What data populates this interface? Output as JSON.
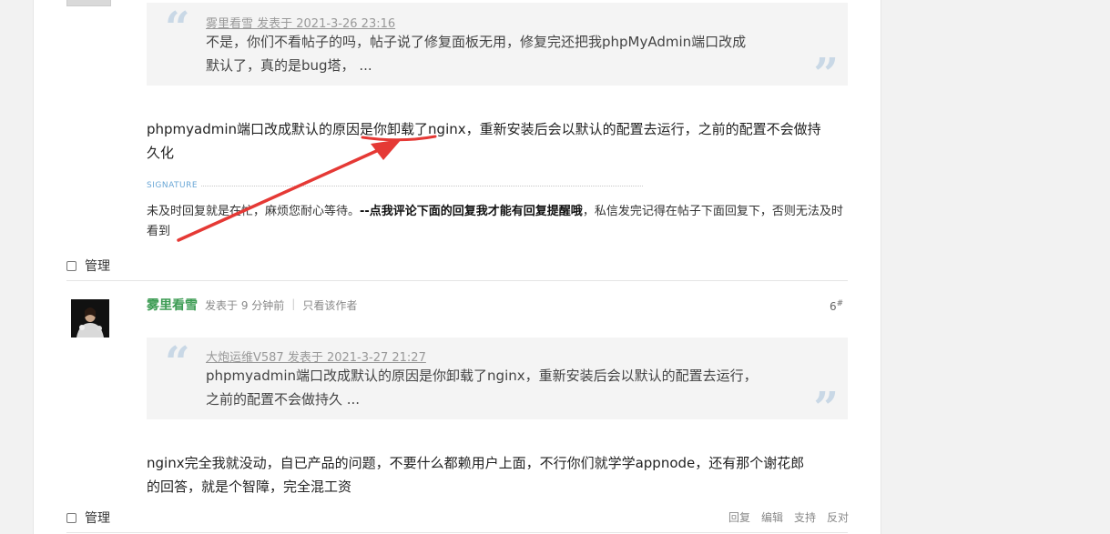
{
  "post1": {
    "quote": {
      "meta": "雾里看雪 发表于 2021-3-26 23:16",
      "line1": "不是，你们不看帖子的吗，帖子说了修复面板无用，修复完还把我phpMyAdmin端口改成",
      "line2": "默认了，真的是bug塔， ..."
    },
    "body_line1": "phpmyadmin端口改成默认的原因是你卸载了nginx，重新安装后会以默认的配置去运行，之前的配置不会做持",
    "body_line2": "久化",
    "signature_label": "SIGNATURE",
    "signature_pre": "未及时回复就是在忙，麻烦您耐心等待。",
    "signature_bold": "--点我评论下面的回复我才能有回复提醒哦",
    "signature_post": "，私信发完记得在帖子下面回复下，否则无法及时看到",
    "manage_label": "管理"
  },
  "post2": {
    "author": "雾里看雪",
    "time": "发表于 9 分钟前",
    "only_author": "只看该作者",
    "floor": "6",
    "floor_mark": "#",
    "quote": {
      "meta": "大炮运维V587 发表于 2021-3-27 21:27",
      "line1": "phpmyadmin端口改成默认的原因是你卸载了nginx，重新安装后会以默认的配置去运行，",
      "line2": "之前的配置不会做持久 ..."
    },
    "body_line1": "nginx完全我就没动，自已产品的问题，不要什么都赖用户上面，不行你们就学学appnode，还有那个谢花郎",
    "body_line2": "的回答，就是个智障，完全混工资",
    "manage_label": "管理",
    "actions": [
      "回复",
      "编辑",
      "支持",
      "反对"
    ]
  },
  "colors": {
    "annotation": "#e53935",
    "author": "#3b9b52",
    "quote_mark": "#c9d8e6"
  }
}
